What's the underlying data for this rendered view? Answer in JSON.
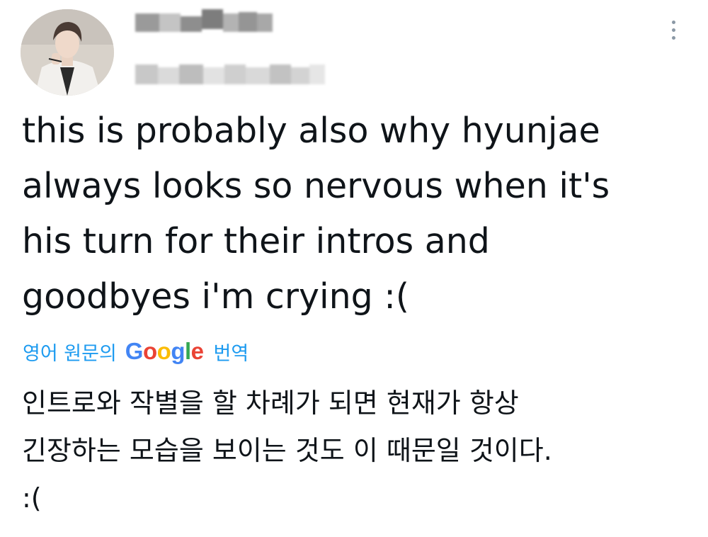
{
  "author": {
    "avatar_icon": "user-avatar-photo",
    "display_name_blurred": true,
    "handle_blurred": true
  },
  "menu": {
    "more_icon": "more-options-icon"
  },
  "tweet": {
    "text": "this is probably also why hyunjae\nalways looks so nervous when it's\nhis turn for their intros and\ngoodbyes i'm crying :("
  },
  "translation": {
    "lead": "영어 원문의",
    "brand": "Google",
    "brand_colors": [
      "#4285f4",
      "#ea4335",
      "#fbbc05",
      "#4285f4",
      "#34a853",
      "#ea4335"
    ],
    "action": "번역",
    "text": "인트로와 작별을 할 차례가 되면 현재가 항상\n긴장하는 모습을 보이는 것도 이 때문일 것이다.\n:("
  },
  "colors": {
    "link": "#1d9bf0",
    "text": "#0f1419",
    "muted": "#8b98a5"
  }
}
